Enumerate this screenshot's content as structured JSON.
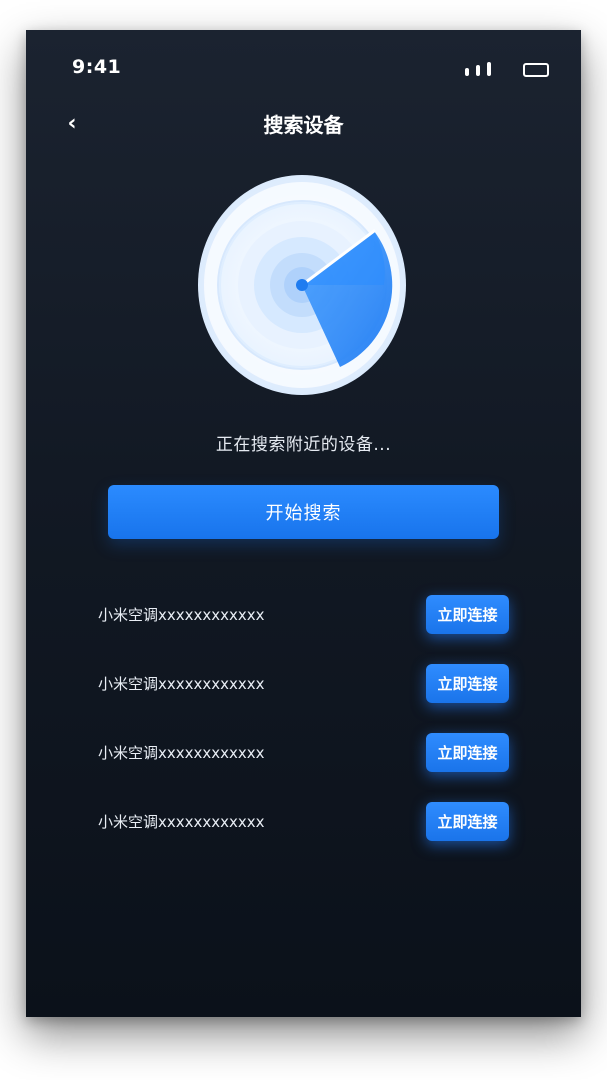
{
  "status_bar": {
    "time": "9:41"
  },
  "nav": {
    "back_icon": "‹",
    "title": "搜索设备"
  },
  "radar": {
    "icon": "radar-scan-icon"
  },
  "search": {
    "status_text": "正在搜索附近的设备...",
    "start_label": "开始搜索"
  },
  "devices": [
    {
      "name": "小米空调xxxxxxxxxxxx",
      "action": "立即连接"
    },
    {
      "name": "小米空调xxxxxxxxxxxx",
      "action": "立即连接"
    },
    {
      "name": "小米空调xxxxxxxxxxxx",
      "action": "立即连接"
    },
    {
      "name": "小米空调xxxxxxxxxxxx",
      "action": "立即连接"
    }
  ],
  "colors": {
    "accent": "#1E7EF7",
    "background": "#111824",
    "text": "#FFFFFF"
  }
}
